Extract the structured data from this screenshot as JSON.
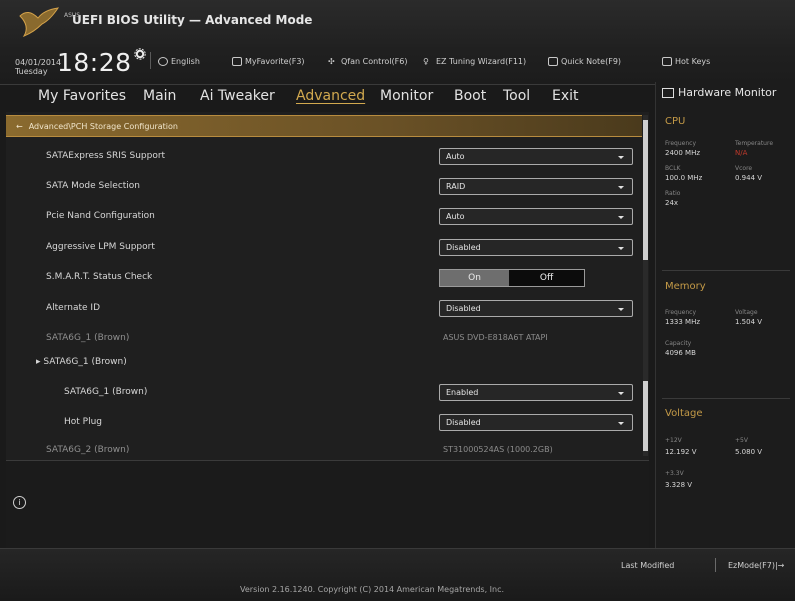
{
  "header": {
    "brand": "ASUS",
    "title": "UEFI BIOS Utility — Advanced Mode",
    "date": "04/01/2014",
    "day": "Tuesday",
    "time": "18:28",
    "toolbar": [
      {
        "label": "English",
        "icon": "globe-icon"
      },
      {
        "label": "MyFavorite(F3)",
        "icon": "favorite-icon"
      },
      {
        "label": "Qfan Control(F6)",
        "icon": "fan-icon"
      },
      {
        "label": "EZ Tuning Wizard(F11)",
        "icon": "wizard-icon"
      },
      {
        "label": "Quick Note(F9)",
        "icon": "note-icon"
      },
      {
        "label": "Hot Keys",
        "icon": "hotkeys-icon"
      }
    ]
  },
  "menu": {
    "items": [
      "My Favorites",
      "Main",
      "Ai Tweaker",
      "Advanced",
      "Monitor",
      "Boot",
      "Tool",
      "Exit"
    ],
    "active": "Advanced"
  },
  "breadcrumb": "Advanced\\PCH Storage Configuration",
  "settings": [
    {
      "label": "SATAExpress SRIS Support",
      "value": "Auto",
      "kind": "select"
    },
    {
      "label": "SATA Mode Selection",
      "value": "RAID",
      "kind": "select"
    },
    {
      "label": "Pcie Nand Configuration",
      "value": "Auto",
      "kind": "select"
    },
    {
      "label": "Aggressive LPM Support",
      "value": "Disabled",
      "kind": "select"
    },
    {
      "label": "S.M.A.R.T. Status Check",
      "on": "On",
      "off": "Off",
      "kind": "toggle"
    },
    {
      "label": "Alternate ID",
      "value": "Disabled",
      "kind": "select"
    },
    {
      "label": "SATA6G_1 (Brown)",
      "value": "ASUS   DVD-E818A6T ATAPI",
      "kind": "static"
    },
    {
      "label": "SATA6G_1 (Brown)",
      "kind": "expander"
    },
    {
      "label": "SATA6G_1 (Brown)",
      "value": "Enabled",
      "kind": "select"
    },
    {
      "label": "Hot Plug",
      "value": "Disabled",
      "kind": "select"
    },
    {
      "label": "SATA6G_2 (Brown)",
      "value": "ST31000524AS (1000.2GB)",
      "kind": "static"
    }
  ],
  "hardware_monitor": {
    "title": "Hardware Monitor",
    "cpu": {
      "label": "CPU",
      "frequency_label": "Frequency",
      "frequency": "2400 MHz",
      "temperature_label": "Temperature",
      "temperature": "N/A",
      "bclk_label": "BCLK",
      "bclk": "100.0 MHz",
      "vcore_label": "Vcore",
      "vcore": "0.944 V",
      "ratio_label": "Ratio",
      "ratio": "24x"
    },
    "memory": {
      "label": "Memory",
      "frequency_label": "Frequency",
      "frequency": "1333 MHz",
      "voltage_label": "Voltage",
      "voltage": "1.504 V",
      "capacity_label": "Capacity",
      "capacity": "4096 MB"
    },
    "voltage": {
      "label": "Voltage",
      "v12_label": "+12V",
      "v12": "12.192 V",
      "v5_label": "+5V",
      "v5": "5.080 V",
      "v33_label": "+3.3V",
      "v33": "3.328 V"
    }
  },
  "footer": {
    "version": "Version 2.16.1240. Copyright (C) 2014 American Megatrends, Inc.",
    "last_modified": "Last Modified",
    "ezmode": "EzMode(F7)|→"
  }
}
